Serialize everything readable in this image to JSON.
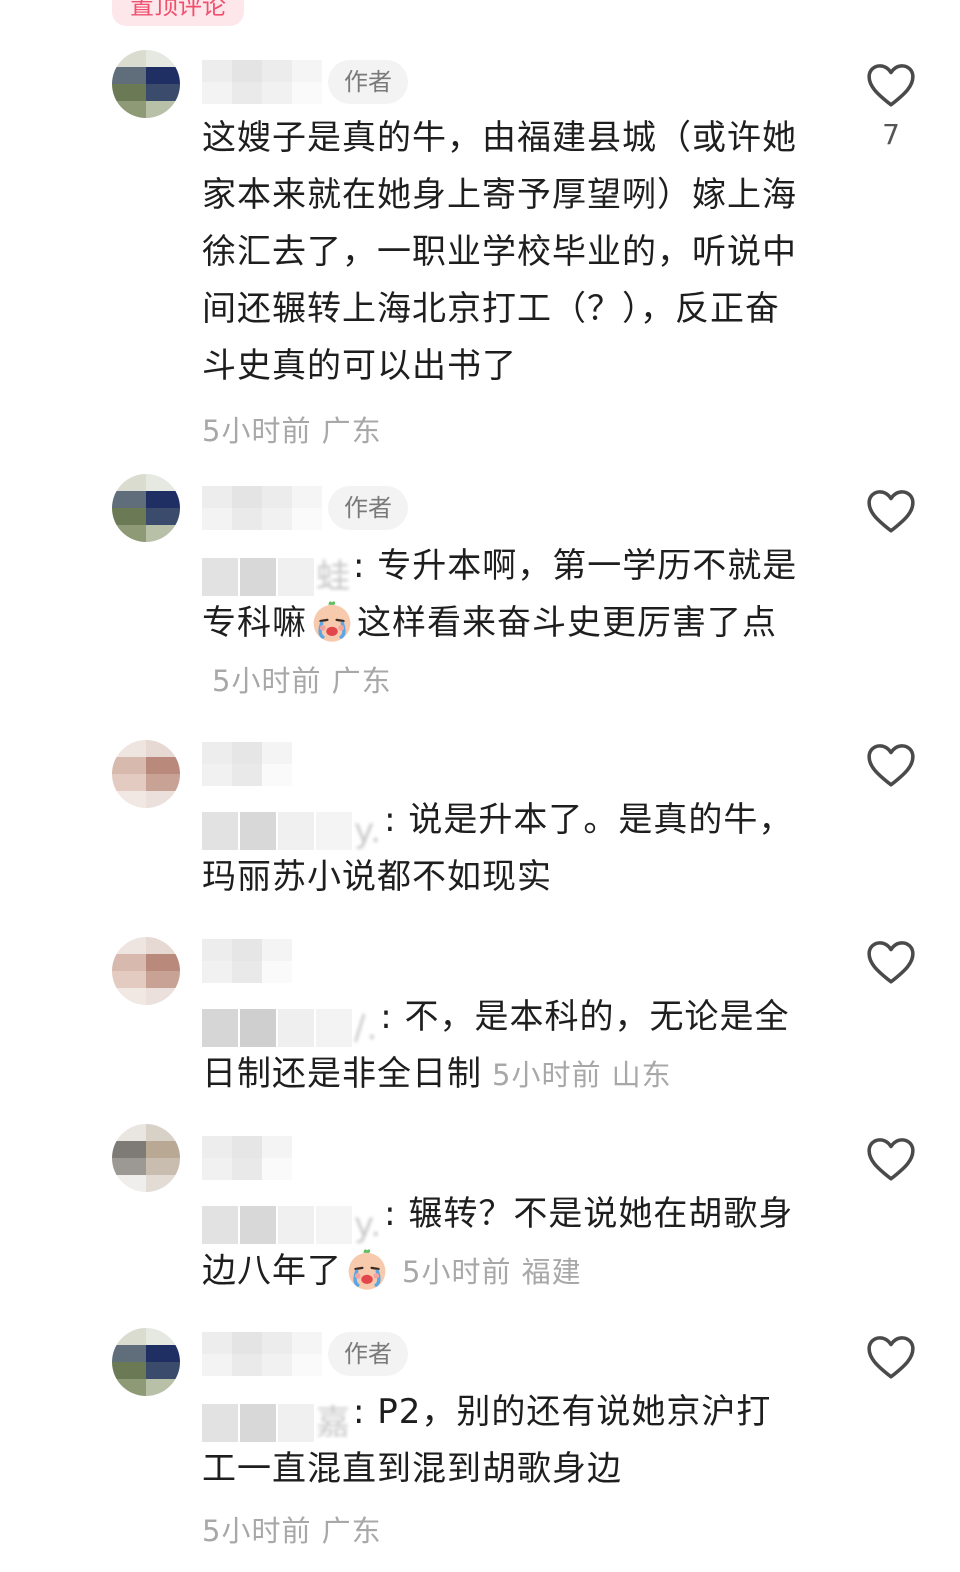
{
  "pinned_label": "置顶评论",
  "author_tag": "作者",
  "comments": [
    {
      "text": "这嫂子是真的牛，由福建县城（或许她家本来就在她身上寄予厚望咧）嫁上海徐汇去了，一职业学校毕业的，听说中间还辗转上海北京打工（？），反正奋斗史真的可以出书了",
      "meta": "5小时前 广东",
      "likes": "7"
    },
    {
      "reply_to_visible": "蛙",
      "text_part1": "专升本啊，第一学历不就是专科嘛",
      "text_part2": "这样看来奋斗史更厉害了点",
      "meta": "5小时前 广东"
    },
    {
      "reply_to_visible": "y.",
      "text": "说是升本了。是真的牛，玛丽苏小说都不如现实"
    },
    {
      "reply_to_visible": "/.",
      "text": "不，是本科的，无论是全日制还是非全日制",
      "meta": "5小时前 山东"
    },
    {
      "reply_to_visible": "y.",
      "text": "辗转？不是说她在胡歌身边八年了",
      "meta": "5小时前 福建"
    },
    {
      "reply_to_visible": "嘉",
      "text": "P2，别的还有说她京沪打工一直混直到混到胡歌身边",
      "meta": "5小时前 广东"
    }
  ],
  "icons": {
    "like": "heart-outline-icon",
    "emoji": "crying-face-emoji"
  },
  "colors": {
    "text": "#1e1e1e",
    "meta": "#a8a8a8",
    "pinned": "#f0506e"
  }
}
